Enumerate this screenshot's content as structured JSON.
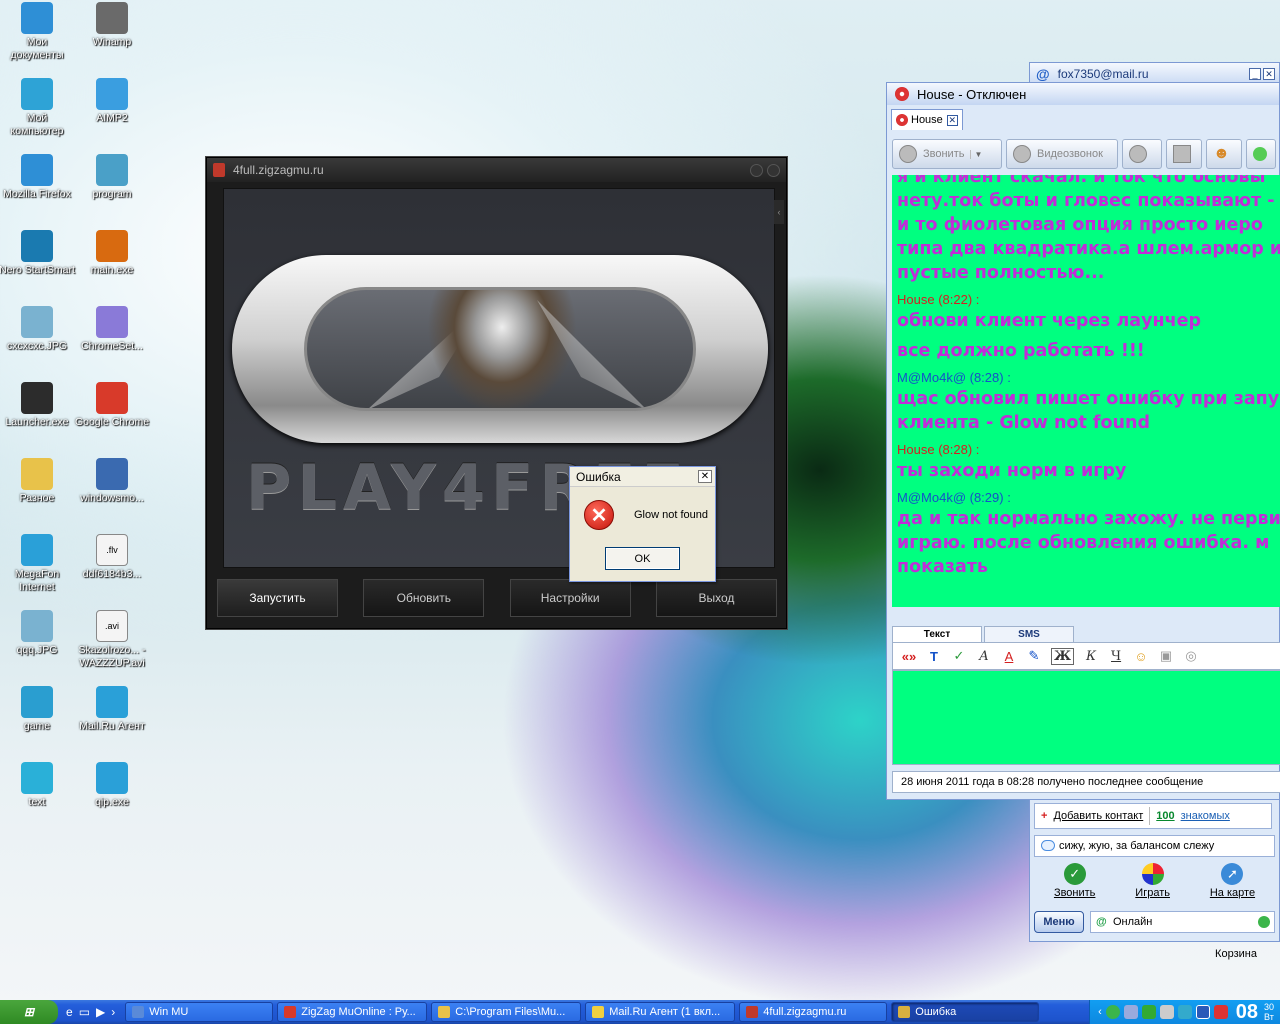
{
  "desktop": {
    "icons": [
      {
        "label": "Мои документы",
        "icon": "my-documents-icon",
        "color": "#2e8fd6"
      },
      {
        "label": "Winamp",
        "icon": "winamp-icon",
        "color": "#6a6a6a"
      },
      {
        "label": "Мой компьютер",
        "icon": "my-computer-icon",
        "color": "#2ea3d6"
      },
      {
        "label": "AIMP2",
        "icon": "aimp-icon",
        "color": "#3a9ee0"
      },
      {
        "label": "Mozilla Firefox",
        "icon": "firefox-icon",
        "color": "#2e8fd6"
      },
      {
        "label": "program",
        "icon": "program-icon",
        "color": "#4aa0c8"
      },
      {
        "label": "Nero StartSmart",
        "icon": "nero-icon",
        "color": "#1a7ab0"
      },
      {
        "label": "main.exe",
        "icon": "main-exe-icon",
        "color": "#d86a10"
      },
      {
        "label": "cxcxcxc.JPG",
        "icon": "image-file-icon",
        "color": "#7ab2d0"
      },
      {
        "label": "ChromeSet...",
        "icon": "chrome-setup-icon",
        "color": "#8a7ad8"
      },
      {
        "label": "Launcher.exe",
        "icon": "launcher-exe-icon",
        "color": "#2c2c2c"
      },
      {
        "label": "Google Chrome",
        "icon": "chrome-icon",
        "color": "#d83a2a"
      },
      {
        "label": "Разное",
        "icon": "folder-icon",
        "color": "#e8c24a"
      },
      {
        "label": "windowsmo...",
        "icon": "windowsmo-icon",
        "color": "#3a6ab0"
      },
      {
        "label": "MegaFon Internet",
        "icon": "megafon-icon",
        "color": "#2aa0d8"
      },
      {
        "label": "ddf6184b3...",
        "icon": "flv-file-icon",
        "color": "#f4f4f4",
        "badge": ".flv"
      },
      {
        "label": "qqq.JPG",
        "icon": "image-file-icon",
        "color": "#7ab2d0"
      },
      {
        "label": "Skazolrozo... -WAZZZUP.avi",
        "icon": "avi-file-icon",
        "color": "#f4f4f4",
        "badge": ".avi"
      },
      {
        "label": "game",
        "icon": "game-icon",
        "color": "#2a9ed0"
      },
      {
        "label": "Mail.Ru Агент",
        "icon": "mailru-agent-icon",
        "color": "#2aa0d8"
      },
      {
        "label": "text",
        "icon": "text-icon",
        "color": "#2ab0d8"
      },
      {
        "label": "qip.exe",
        "icon": "qip-icon",
        "color": "#2aa0d8"
      }
    ],
    "trash_label": "Корзина"
  },
  "launcher": {
    "title": "4full.zigzagmu.ru",
    "brand": "PLAY4FREE",
    "buttons": {
      "start": "Запустить",
      "update": "Обновить",
      "settings": "Настройки",
      "exit": "Выход"
    }
  },
  "error_dialog": {
    "title": "Ошибка",
    "message": "Glow not found",
    "ok": "OK",
    "close": "✕"
  },
  "agent": {
    "account": "fox7350@mail.ru",
    "add_contact": "Добавить контакт",
    "acquaintances_count": "100",
    "acquaintances_label": "знакомых",
    "status_text": "сижу, жую, за балансом слежу",
    "actions": {
      "call": "Звонить",
      "play": "Играть",
      "map": "На карте"
    },
    "menu": "Меню",
    "online": "Онлайн"
  },
  "chat": {
    "title": "House - Отключен",
    "tab": "House",
    "toolbar": {
      "call": "Звонить",
      "video": "Видеозвонок"
    },
    "messages": [
      {
        "lines": [
          "я и клиент скачал. и ток  что основы",
          "нету.ток боты и гловес показывают -",
          "и  то фиолетовая опция просто иеро",
          "типа два квадратика.а шлем.армор и",
          "пустые полностью..."
        ]
      },
      {
        "author": "House",
        "time": "(8:22) :",
        "from_me": false,
        "lines": [
          "обнови клиент через лаунчер",
          "все должно работать !!!"
        ]
      },
      {
        "author": "M@Mo4k@",
        "time": "(8:28) :",
        "from_me": true,
        "lines": [
          "щас обновил пишет ошибку при запу",
          "клиента - Glow not found"
        ]
      },
      {
        "author": "House",
        "time": "(8:28) :",
        "from_me": false,
        "lines": [
          "ты заходи норм в игру"
        ]
      },
      {
        "author": "M@Mo4k@",
        "time": "(8:29) :",
        "from_me": true,
        "lines": [
          "да и так нормально захожу. не перви",
          "играю. после обновления ошибка. м",
          "показать"
        ]
      }
    ],
    "input_tabs": {
      "text": "Текст",
      "sms": "SMS"
    },
    "format_tools": {
      "quote": "«»",
      "bold": "Ж",
      "italic": "К",
      "underline": "Ч"
    },
    "status_line": "28 июня 2011 года в 08:28 получено последнее сообщение"
  },
  "taskbar": {
    "tasks": [
      {
        "label": "Win MU",
        "icon": "win-mu-icon",
        "color": "#5a8ad8",
        "active": false,
        "width": 148
      },
      {
        "label": "ZigZag MuOnline : Ру...",
        "icon": "chrome-icon",
        "color": "#d83a2a",
        "active": false,
        "width": 150
      },
      {
        "label": "C:\\Program Files\\Mu...",
        "icon": "folder-icon",
        "color": "#e8c24a",
        "active": false,
        "width": 150
      },
      {
        "label": "Mail.Ru Агент (1 вкл...",
        "icon": "mail-icon",
        "color": "#f0d040",
        "active": false,
        "width": 150
      },
      {
        "label": "4full.zigzagmu.ru",
        "icon": "launcher-icon",
        "color": "#c0392b",
        "active": false,
        "width": 148
      },
      {
        "label": "Ошибка",
        "icon": "error-window-icon",
        "color": "#d8b040",
        "active": true,
        "width": 148
      }
    ],
    "clock": "08",
    "clock_minutes": "30",
    "clock_day": "Вт"
  }
}
